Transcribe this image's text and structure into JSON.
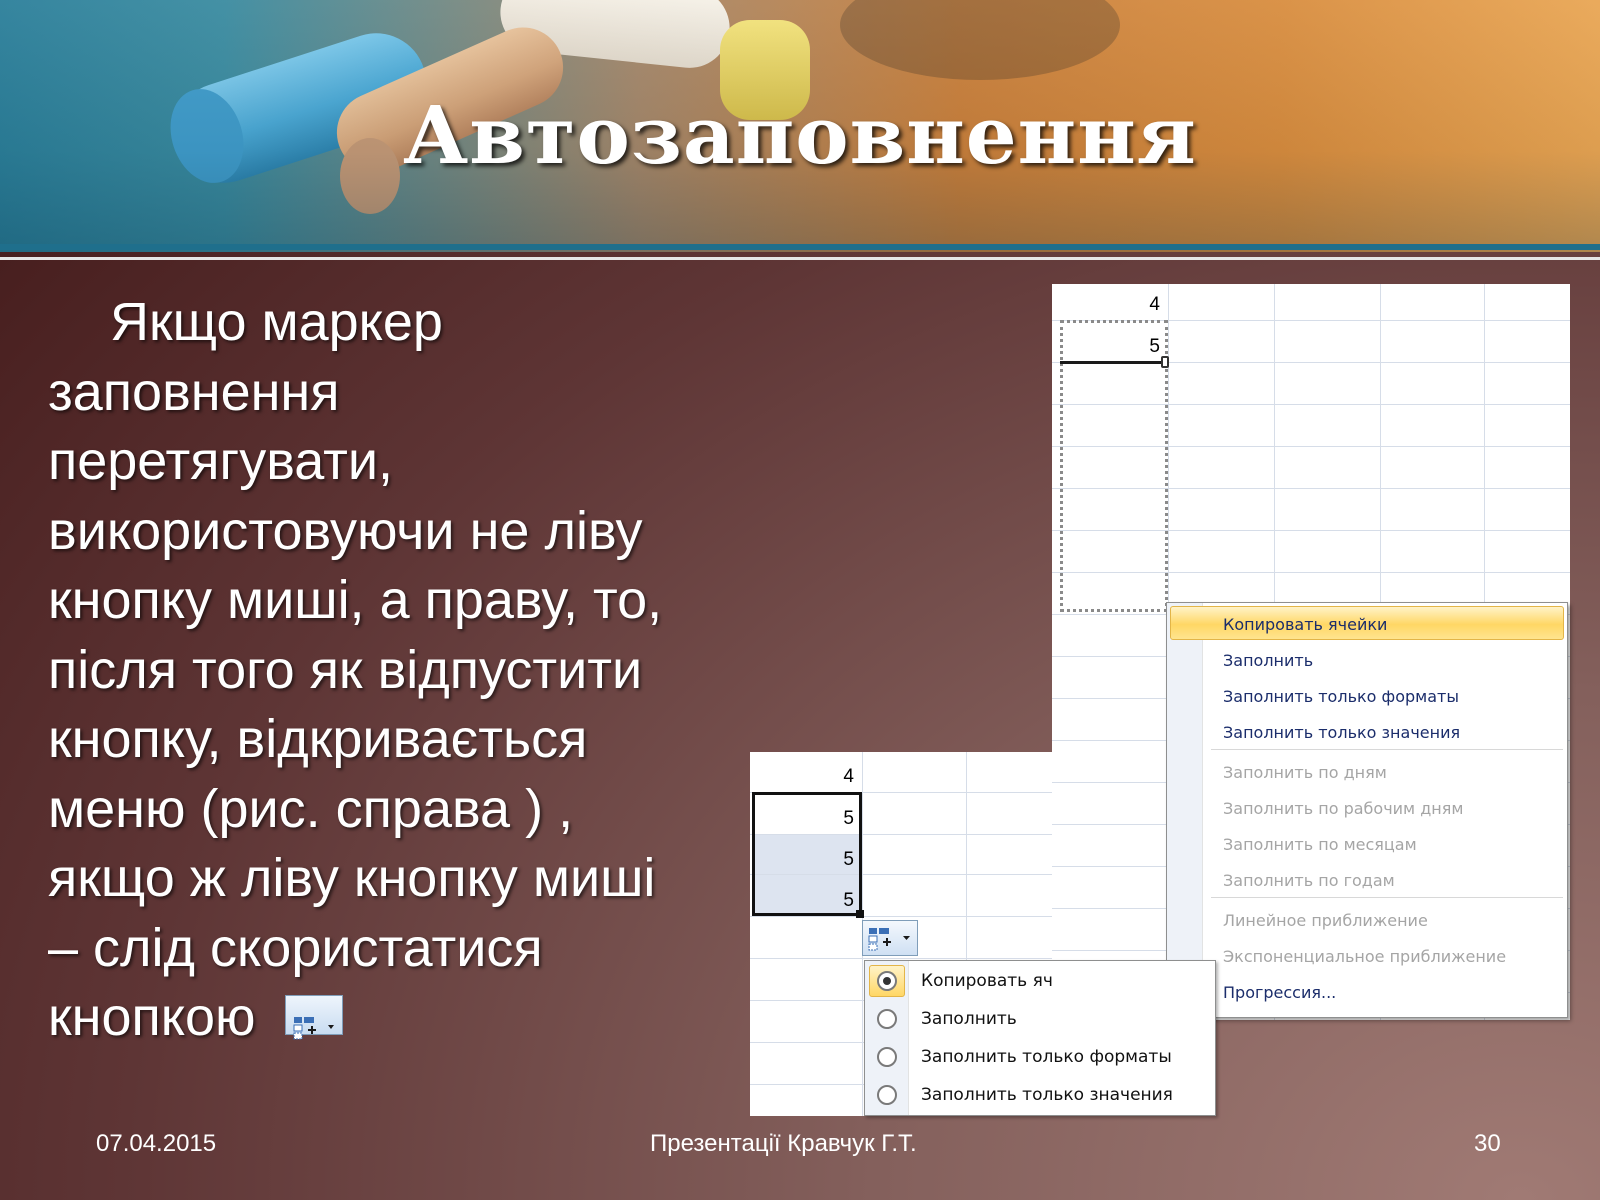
{
  "slide": {
    "title": "Автозаповнення",
    "body_lines": [
      "Якщо маркер",
      "заповнення",
      "перетягувати,",
      "використовуючи не ліву",
      "кнопку миші, а праву, то,",
      "після того як відпустити",
      "кнопку, відкривається",
      "меню (рис. справа ) ,",
      "якщо ж ліву кнопку миші",
      "– слід скористатися",
      "кнопкою"
    ],
    "inline_icon": "autofill-options-icon"
  },
  "sheet_big": {
    "cells": [
      "4",
      "5"
    ]
  },
  "context_menu": {
    "items": [
      "Копировать ячейки",
      "Заполнить",
      "Заполнить только форматы",
      "Заполнить только значения",
      "Заполнить по дням",
      "Заполнить по рабочим дням",
      "Заполнить по месяцам",
      "Заполнить по годам",
      "Линейное приближение",
      "Экспоненциальное приближение",
      "Прогрессия..."
    ],
    "disabled": [
      false,
      false,
      false,
      false,
      true,
      true,
      true,
      true,
      true,
      true,
      false
    ],
    "highlighted_index": 0,
    "highlight_color": "#ffd765"
  },
  "sheet_small": {
    "cells": [
      "4",
      "5",
      "5",
      "5"
    ]
  },
  "autofill_menu": {
    "items": [
      "Копировать яч",
      "Заполнить",
      "Заполнить только форматы",
      "Заполнить только значения"
    ],
    "selected_index": 0
  },
  "footer": {
    "date": "07.04.2015",
    "author": "Презентації Кравчук Г.Т.",
    "page": "30"
  },
  "colors": {
    "accent_line": "#1f6f8c",
    "menu_text": "#1b2d6b",
    "menu_disabled": "#a5a5a5"
  }
}
